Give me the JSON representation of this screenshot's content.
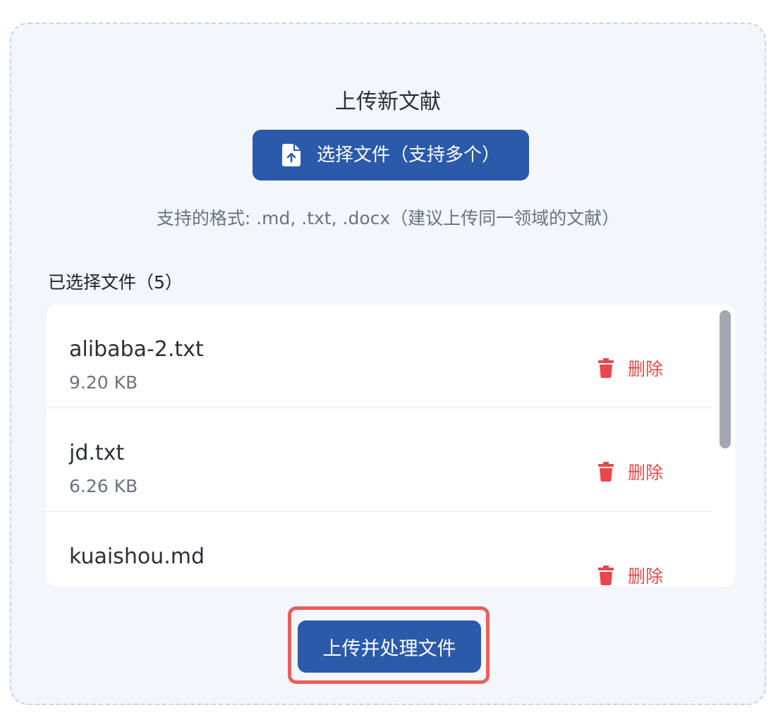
{
  "upload": {
    "title": "上传新文献",
    "choose_button_label": "选择文件（支持多个）",
    "choose_button_icon": "file-upload-icon",
    "formats_hint": "支持的格式: .md, .txt, .docx（建议上传同一领域的文献）",
    "selected_title": "已选择文件（5）",
    "files": [
      {
        "name": "alibaba-2.txt",
        "size": "9.20 KB",
        "delete_label": "删除"
      },
      {
        "name": "jd.txt",
        "size": "6.26 KB",
        "delete_label": "删除"
      },
      {
        "name": "kuaishou.md",
        "size": "",
        "delete_label": "删除"
      }
    ],
    "submit_button_label": "上传并处理文件"
  },
  "colors": {
    "primary": "#2b5aaa",
    "danger": "#e5484d",
    "highlight": "#e8605a",
    "panel_bg": "#f3f6fb"
  }
}
